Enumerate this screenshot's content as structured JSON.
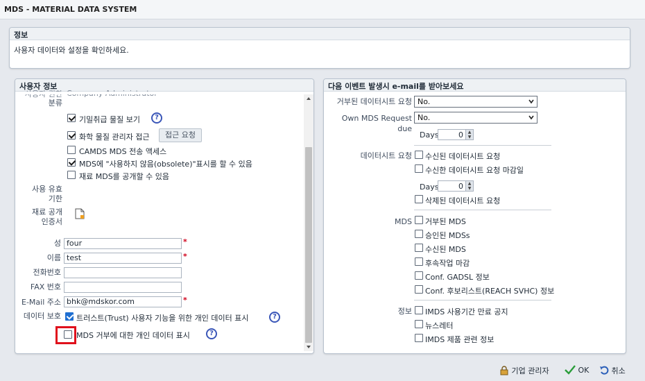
{
  "window": {
    "title": "MDS - MATERIAL DATA SYSTEM"
  },
  "info": {
    "heading": "정보",
    "text": "사용자 데이터와 설정을 확인하세요."
  },
  "user_panel": {
    "heading": "사용자 정보",
    "role_label_partial": "사용자 권한",
    "role_value_partial": "Company Administrator",
    "category_label": "분류",
    "permissions": [
      {
        "label": "기밀취급 물질 보기",
        "checked": true
      },
      {
        "label": "화학 물질 관리자 접근",
        "checked": true
      },
      {
        "label": "CAMDS MDS 전송 액세스",
        "checked": false
      },
      {
        "label": "MDS에 \"사용하지 않음(obsolete)\"표시를 할 수 있음",
        "checked": true
      },
      {
        "label": "재료 MDS를 공개할 수 있음",
        "checked": false
      }
    ],
    "access_request_button": "접근 요청",
    "validity_label_1": "사용 유효",
    "validity_label_2": "기한",
    "cert_label_1": "재료 공개",
    "cert_label_2": "인증서",
    "fields": {
      "last_name": {
        "label": "성",
        "value": "four"
      },
      "first_name": {
        "label": "이름",
        "value": "test"
      },
      "phone": {
        "label": "전화번호",
        "value": ""
      },
      "fax": {
        "label": "FAX 번호",
        "value": ""
      },
      "email": {
        "label": "E-Mail 주소",
        "value": "bhk@mdskor.com"
      }
    },
    "data_protection_label": "데이터 보호",
    "data_protection": [
      {
        "label": "트러스트(Trust) 사용자 기능을 위한 개인 데이터 표시",
        "checked": true
      },
      {
        "label": "MDS 거부에 대한 개인 데이터 표시",
        "checked": false
      }
    ]
  },
  "email_panel": {
    "heading": "다음 이벤트 발생시 e-mail를 받아보세요",
    "rejected_request_label": "거부된 데이터시트 요청",
    "rejected_request_value": "No.",
    "own_due_label": "Own MDS Request due",
    "own_due_value": "No.",
    "days_label": "Days",
    "days_value_1": "0",
    "datasheet_label": "데이터시트 요청",
    "datasheet_options": [
      "수신된 데이터시트 요청",
      "수신한 데이터시트 요청 마감일"
    ],
    "days_value_2": "0",
    "deleted_request": "삭제된 데이터시트 요청",
    "mds_label": "MDS",
    "mds_options": [
      "거부된 MDS",
      "승인된 MDSs",
      "수신된 MDS",
      "후속작업 마감",
      "Conf. GADSL 정보",
      "Conf. 후보리스트(REACH SVHC) 정보"
    ],
    "info_label": "정보",
    "info_options": [
      "IMDS 사용기간 만료 공지",
      "뉴스레터",
      "IMDS 제품 관련 정보"
    ]
  },
  "footer": {
    "admin": "기업 관리자",
    "ok": "OK",
    "cancel": "취소"
  },
  "colors": {
    "highlight": "#e0101c",
    "help": "#3a56b8",
    "required": "#d0021b",
    "ok": "#2a9d3a"
  }
}
